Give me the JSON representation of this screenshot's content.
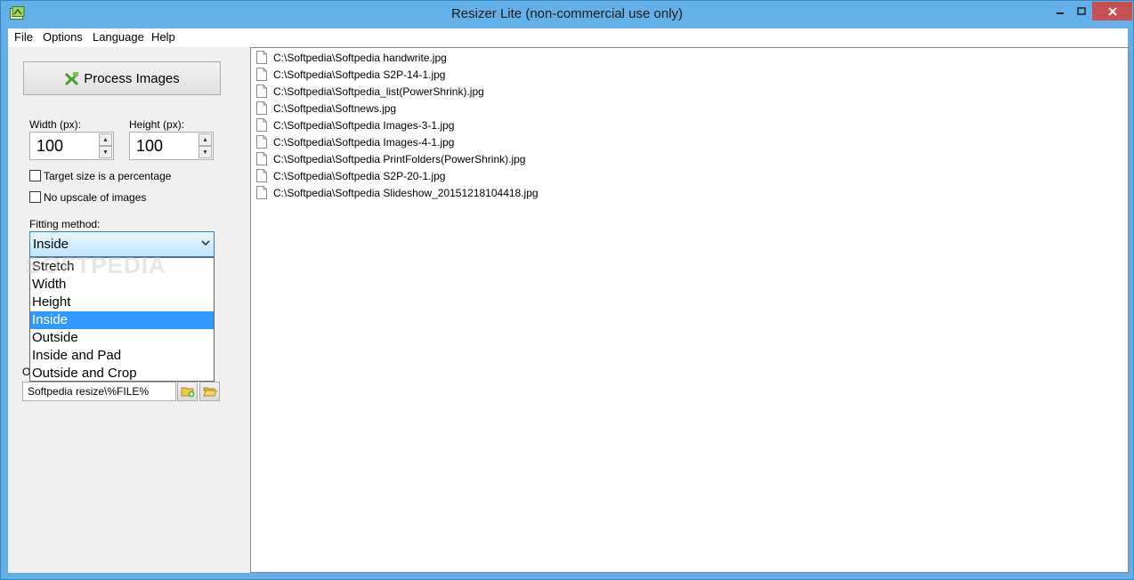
{
  "window": {
    "title": "Resizer Lite (non-commercial use only)"
  },
  "menu": [
    "File",
    "Options",
    "Language",
    "Help"
  ],
  "left": {
    "process_label": "Process Images",
    "width_label": "Width (px):",
    "height_label": "Height (px):",
    "width_value": "100",
    "height_value": "100",
    "target_percentage_label": "Target size is a percentage",
    "no_upscale_label": "No upscale of images",
    "fitting_label": "Fitting method:",
    "fitting_selected": "Inside",
    "fitting_options": [
      "Stretch",
      "Width",
      "Height",
      "Inside",
      "Outside",
      "Inside and Pad",
      "Outside and Crop"
    ],
    "output_label_partial": "O",
    "output_value": "Softpedia resize\\%FILE%"
  },
  "watermark": "SOFTPEDIA",
  "files": [
    "C:\\Softpedia\\Softpedia handwrite.jpg",
    "C:\\Softpedia\\Softpedia S2P-14-1.jpg",
    "C:\\Softpedia\\Softpedia_list(PowerShrink).jpg",
    "C:\\Softpedia\\Softnews.jpg",
    "C:\\Softpedia\\Softpedia Images-3-1.jpg",
    "C:\\Softpedia\\Softpedia Images-4-1.jpg",
    "C:\\Softpedia\\Softpedia PrintFolders(PowerShrink).jpg",
    "C:\\Softpedia\\Softpedia S2P-20-1.jpg",
    "C:\\Softpedia\\Softpedia Slideshow_20151218104418.jpg"
  ],
  "colors": {
    "titlebar": "#64b0e8",
    "close": "#c75050",
    "selection": "#3399ff"
  }
}
